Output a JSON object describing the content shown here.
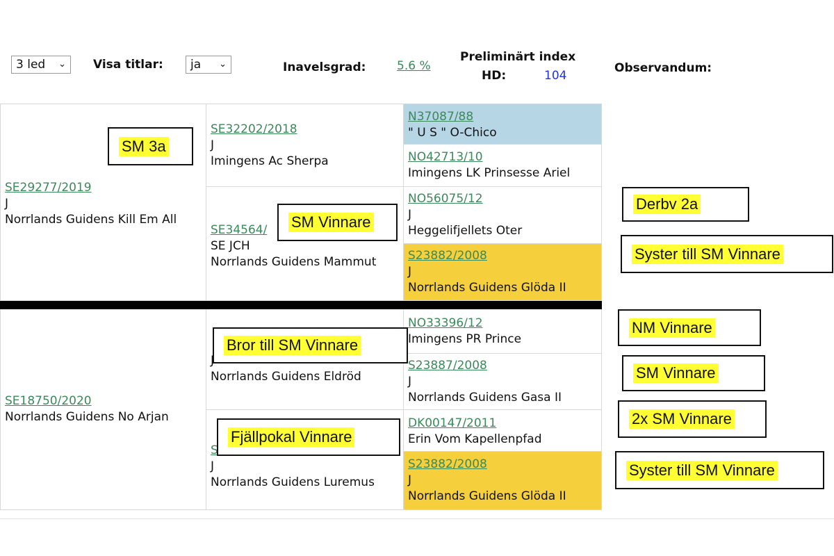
{
  "toolbar": {
    "generations_select": "3 led",
    "visa_titlar_label": "Visa titlar:",
    "visa_titlar_select": "ja",
    "inavelsgrad_label": "Inavelsgrad:",
    "inavelsgrad_value": "5.6 %",
    "prelim_label": "Preliminärt index",
    "hd_label": "HD:",
    "hd_value": "104",
    "observandum_label": "Observandum:"
  },
  "pedigree": {
    "sire": {
      "reg": "SE29277/2019",
      "title": "J",
      "name": "Norrlands Guidens Kill Em All"
    },
    "dam": {
      "reg": "SE18750/2020",
      "name": "Norrlands Guidens No Arjan"
    },
    "ss": {
      "reg": "SE32202/2018",
      "title": "J",
      "name": "Imingens Ac Sherpa"
    },
    "sd": {
      "reg": "SE34564/",
      "title": "SE JCH",
      "name": "Norrlands Guidens Mammut"
    },
    "ds": {
      "reg": "",
      "title": "J",
      "name": "Norrlands Guidens Eldröd"
    },
    "dd": {
      "reg": "S",
      "title": "J",
      "name": "Norrlands Guidens Luremus"
    },
    "sss": {
      "reg": "N37087/88",
      "name": "\" U S \" O-Chico"
    },
    "ssd": {
      "reg": "NO42713/10",
      "name": "Imingens LK Prinsesse Ariel"
    },
    "sds": {
      "reg": "NO56075/12",
      "title": "J",
      "name": "Heggelifjellets Oter"
    },
    "sdd": {
      "reg": "S23882/2008",
      "title": "J",
      "name": "Norrlands Guidens Glöda II"
    },
    "dss": {
      "reg": "NO33396/12",
      "name": "Imingens PR Prince"
    },
    "dsd": {
      "reg": "S23887/2008",
      "title": "J",
      "name": "Norrlands Guidens Gasa II"
    },
    "dds": {
      "reg": "DK00147/2011",
      "name": "Erin Vom Kapellenpfad"
    },
    "ddd": {
      "reg": "S23882/2008",
      "title": "J",
      "name": "Norrlands Guidens Glöda II"
    }
  },
  "annotations": {
    "sm3a": "SM 3a",
    "sm_vinnare_1": "SM Vinnare",
    "derby": "Derbv 2a",
    "syster_1": "Syster till SM Vinnare",
    "bror": "Bror till SM Vinnare",
    "nm": "NM Vinnare",
    "sm_vinnare_2": "SM Vinnare",
    "fjallpokal": "Fjällpokal Vinnare",
    "twox_sm": "2x SM Vinnare",
    "syster_2": "Syster till SM Vinnare"
  },
  "colors": {
    "link_green": "#3a8a5a",
    "hd_blue": "#2233dd",
    "highlight_blue": "#b6d6e6",
    "highlight_gold": "#f5cf3c",
    "label_yellow": "#ffff33"
  }
}
